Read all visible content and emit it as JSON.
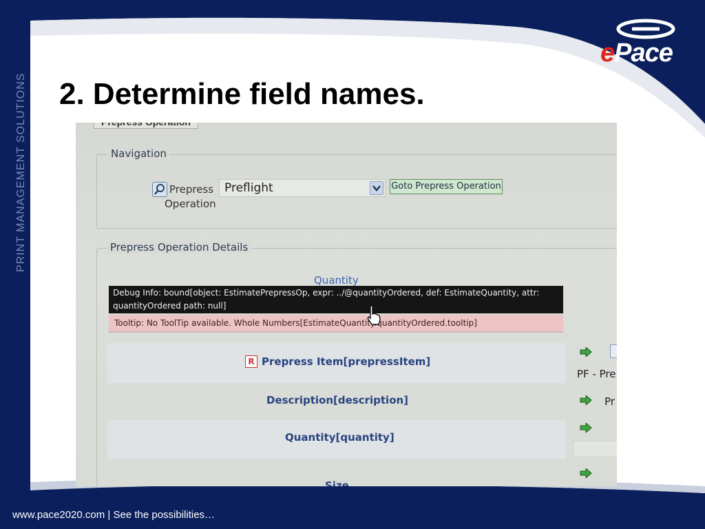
{
  "slide": {
    "title": "2. Determine field names.",
    "side_banner": "PRINT MANAGEMENT SOLUTIONS",
    "footer": "www.pace2020.com | See the possibilities…",
    "logo": {
      "prefix": "e",
      "name": "Pace"
    },
    "colors": {
      "navy": "#0b1f5c",
      "white": "#ffffff",
      "logo_red": "#e2231a"
    }
  },
  "screen": {
    "tab_label": "Prepress Operation",
    "navigation": {
      "legend": "Navigation",
      "label_line1": "Prepress",
      "label_line2": "Operation",
      "select_value": "Preflight",
      "goto_button": "Goto Prepress Operation"
    },
    "details": {
      "legend": "Prepress Operation Details",
      "quantity_heading": "Quantity",
      "debug_line1": "Debug Info: bound[object: EstimatePrepressOp, expr: ../@quantityOrdered, def: EstimateQuantity, attr:",
      "debug_line2": "quantityOrdered path: null]",
      "tooltip": "Tooltip: No ToolTip available. Whole Numbers[EstimateQuantity.quantityOrdered.tooltip]",
      "rows": {
        "prepress_item": "Prepress Item[prepressItem]",
        "description": "Description[description]",
        "quantity": "Quantity[quantity]",
        "size": "Size"
      },
      "r_icon": "R",
      "side_values": {
        "pf": "PF - Pre",
        "pr": "Pr"
      }
    },
    "colors": {
      "debug_bg": "#151515",
      "tooltip_bg": "#eec3c3",
      "label_blue": "#28437f",
      "goto_bg": "#cfe6cf"
    }
  }
}
